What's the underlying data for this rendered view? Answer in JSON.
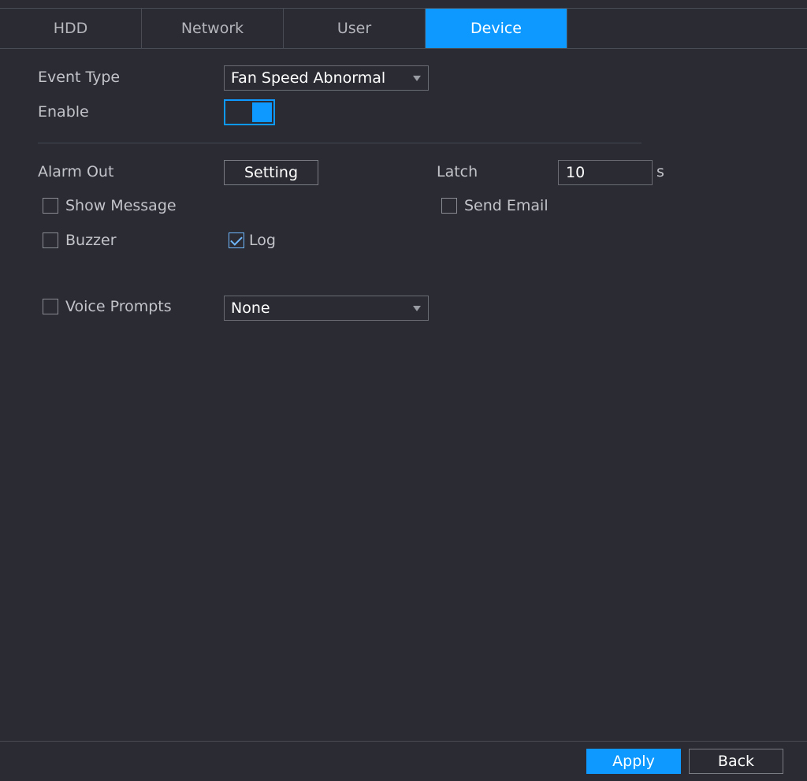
{
  "tabs": [
    {
      "label": "HDD"
    },
    {
      "label": "Network"
    },
    {
      "label": "User"
    },
    {
      "label": "Device"
    }
  ],
  "active_tab": "Device",
  "form": {
    "event_type_label": "Event Type",
    "event_type_value": "Fan Speed Abnormal",
    "enable_label": "Enable",
    "enable_on": true,
    "alarm_out_label": "Alarm Out",
    "setting_button": "Setting",
    "latch_label": "Latch",
    "latch_value": "10",
    "latch_unit": "s",
    "show_message_label": "Show Message",
    "show_message_checked": false,
    "send_email_label": "Send Email",
    "send_email_checked": false,
    "buzzer_label": "Buzzer",
    "buzzer_checked": false,
    "log_label": "Log",
    "log_checked": true,
    "voice_prompts_label": "Voice Prompts",
    "voice_prompts_checked": false,
    "voice_prompts_value": "None"
  },
  "footer": {
    "apply_label": "Apply",
    "back_label": "Back"
  },
  "colors": {
    "accent": "#0d99ff",
    "background": "#2a2b33"
  }
}
